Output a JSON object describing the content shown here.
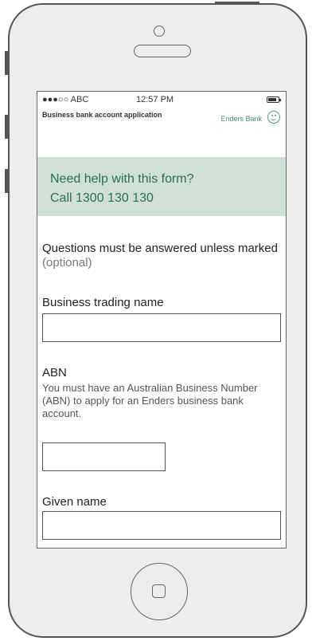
{
  "device": {
    "type": "iPhone mockup",
    "frame_color": "#ededed"
  },
  "status_bar": {
    "carrier": "●●●○○ ABC",
    "time": "12:57 PM",
    "battery_icon": "battery-icon"
  },
  "header": {
    "title": "Business bank account application",
    "bank_name": "Enders Bank",
    "logo_icon": "smiley-face-icon",
    "accent_color": "#4c8b73"
  },
  "help_box": {
    "line1": "Need help with this form?",
    "line2": "Call 1300 130 130",
    "background_color": "#cfe1d7",
    "text_color": "#2d6d53"
  },
  "intro": {
    "text": "Questions must be answered unless marked",
    "optional": "(optional)"
  },
  "form": {
    "business_trading_name": {
      "label": "Business trading name",
      "value": ""
    },
    "abn": {
      "label": "ABN",
      "hint": "You must have an Australian Business Number (ABN) to apply for an Enders business bank account.",
      "value": ""
    },
    "given_name": {
      "label": "Given name",
      "value": ""
    }
  }
}
